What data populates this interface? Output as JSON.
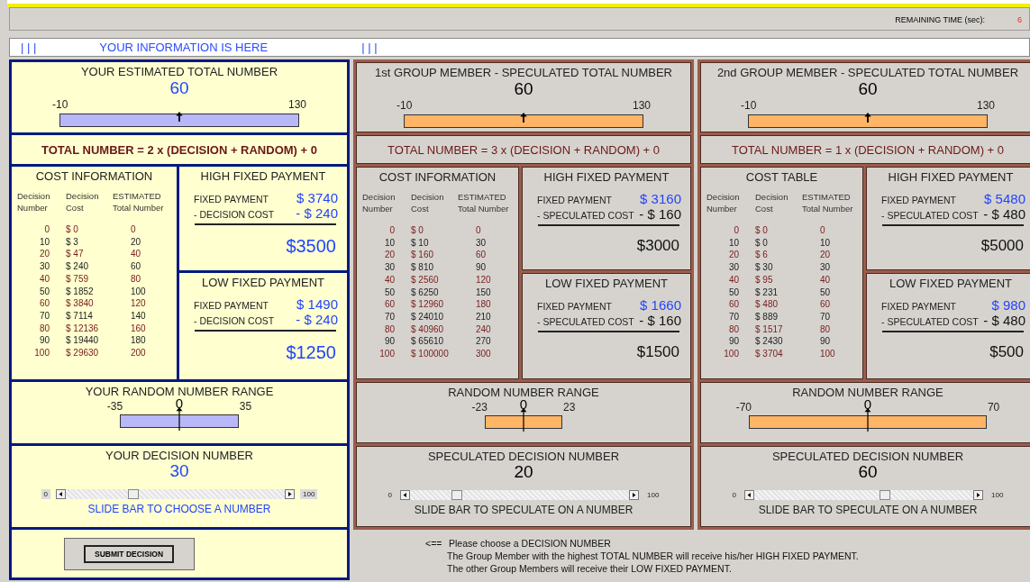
{
  "top_bar": {
    "label": "REMAINING TIME (sec):",
    "value": "6"
  },
  "info_bar": {
    "left_marks": "| | |",
    "text": "YOUR INFORMATION IS HERE",
    "right_marks": "| | |"
  },
  "panels": [
    {
      "kind": "self",
      "total": {
        "title": "YOUR ESTIMATED TOTAL NUMBER",
        "value": "60",
        "min": "-10",
        "max": "130",
        "level": 0.5
      },
      "formula": "TOTAL NUMBER = 2 x (DECISION + RANDOM) + 0",
      "cost": {
        "title": "COST INFORMATION",
        "columns": [
          "Decision\nNumber",
          "Decision\nCost",
          "ESTIMATED\nTotal Number"
        ],
        "rows": [
          [
            "0",
            "$ 0",
            "0"
          ],
          [
            "10",
            "$ 3",
            "20"
          ],
          [
            "20",
            "$ 47",
            "40"
          ],
          [
            "30",
            "$ 240",
            "60"
          ],
          [
            "40",
            "$ 759",
            "80"
          ],
          [
            "50",
            "$ 1852",
            "100"
          ],
          [
            "60",
            "$ 3840",
            "120"
          ],
          [
            "70",
            "$ 7114",
            "140"
          ],
          [
            "80",
            "$ 12136",
            "160"
          ],
          [
            "90",
            "$ 19440",
            "180"
          ],
          [
            "100",
            "$ 29630",
            "200"
          ]
        ]
      },
      "payments": [
        {
          "title": "HIGH FIXED PAYMENT",
          "fixed_label": "FIXED PAYMENT",
          "fixed_value": "$ 3740",
          "cost_label": "- DECISION COST",
          "cost_value": "- $ 240",
          "net": "$3500"
        },
        {
          "title": "LOW FIXED PAYMENT",
          "fixed_label": "FIXED PAYMENT",
          "fixed_value": "$ 1490",
          "cost_label": "- DECISION COST",
          "cost_value": "- $ 240",
          "net": "$1250"
        }
      ],
      "random": {
        "title": "YOUR RANDOM NUMBER RANGE",
        "min": "-35",
        "center": "0",
        "max": "35"
      },
      "decision": {
        "title": "YOUR DECISION NUMBER",
        "value": "30",
        "min": "0",
        "max": "100",
        "level": 0.3,
        "hint": "SLIDE BAR TO CHOOSE A NUMBER"
      }
    },
    {
      "kind": "member",
      "total": {
        "title": "1st GROUP MEMBER - SPECULATED TOTAL NUMBER",
        "value": "60",
        "min": "-10",
        "max": "130",
        "level": 0.5
      },
      "formula": "TOTAL NUMBER = 3 x (DECISION + RANDOM) + 0",
      "cost": {
        "title": "COST INFORMATION",
        "columns": [
          "Decision\nNumber",
          "Decision\nCost",
          "ESTIMATED\nTotal Number"
        ],
        "rows": [
          [
            "0",
            "$ 0",
            "0"
          ],
          [
            "10",
            "$ 10",
            "30"
          ],
          [
            "20",
            "$ 160",
            "60"
          ],
          [
            "30",
            "$ 810",
            "90"
          ],
          [
            "40",
            "$ 2560",
            "120"
          ],
          [
            "50",
            "$ 6250",
            "150"
          ],
          [
            "60",
            "$ 12960",
            "180"
          ],
          [
            "70",
            "$ 24010",
            "210"
          ],
          [
            "80",
            "$ 40960",
            "240"
          ],
          [
            "90",
            "$ 65610",
            "270"
          ],
          [
            "100",
            "$ 100000",
            "300"
          ]
        ]
      },
      "payments": [
        {
          "title": "HIGH FIXED PAYMENT",
          "fixed_label": "FIXED PAYMENT",
          "fixed_value": "$ 3160",
          "cost_label": "- SPECULATED COST",
          "cost_value": "- $ 160",
          "net": "$3000"
        },
        {
          "title": "LOW FIXED PAYMENT",
          "fixed_label": "FIXED PAYMENT",
          "fixed_value": "$ 1660",
          "cost_label": "- SPECULATED COST",
          "cost_value": "- $ 160",
          "net": "$1500"
        }
      ],
      "random": {
        "title": "RANDOM NUMBER RANGE",
        "min": "-23",
        "center": "0",
        "max": "23"
      },
      "decision": {
        "title": "SPECULATED DECISION NUMBER",
        "value": "20",
        "min": "0",
        "max": "100",
        "level": 0.2,
        "hint": "SLIDE BAR TO SPECULATE ON A NUMBER"
      }
    },
    {
      "kind": "member",
      "total": {
        "title": "2nd GROUP MEMBER - SPECULATED TOTAL NUMBER",
        "value": "60",
        "min": "-10",
        "max": "130",
        "level": 0.5
      },
      "formula": "TOTAL NUMBER = 1 x (DECISION + RANDOM) + 0",
      "cost": {
        "title": "COST  TABLE",
        "columns": [
          "Decision\nNumber",
          "Decision\nCost",
          "ESTIMATED\nTotal Number"
        ],
        "rows": [
          [
            "0",
            "$ 0",
            "0"
          ],
          [
            "10",
            "$ 0",
            "10"
          ],
          [
            "20",
            "$ 6",
            "20"
          ],
          [
            "30",
            "$ 30",
            "30"
          ],
          [
            "40",
            "$ 95",
            "40"
          ],
          [
            "50",
            "$ 231",
            "50"
          ],
          [
            "60",
            "$ 480",
            "60"
          ],
          [
            "70",
            "$ 889",
            "70"
          ],
          [
            "80",
            "$ 1517",
            "80"
          ],
          [
            "90",
            "$ 2430",
            "90"
          ],
          [
            "100",
            "$ 3704",
            "100"
          ]
        ]
      },
      "payments": [
        {
          "title": "HIGH FIXED PAYMENT",
          "fixed_label": "FIXED PAYMENT",
          "fixed_value": "$ 5480",
          "cost_label": "- SPECULATED COST",
          "cost_value": "- $ 480",
          "net": "$5000"
        },
        {
          "title": "LOW FIXED PAYMENT",
          "fixed_label": "FIXED PAYMENT",
          "fixed_value": "$ 980",
          "cost_label": "- SPECULATED COST",
          "cost_value": "- $ 480",
          "net": "$500"
        }
      ],
      "random": {
        "title": "RANDOM NUMBER RANGE",
        "min": "-70",
        "center": "0",
        "max": "70"
      },
      "decision": {
        "title": "SPECULATED DECISION NUMBER",
        "value": "60",
        "min": "0",
        "max": "100",
        "level": 0.6,
        "hint": "SLIDE BAR TO SPECULATE ON A NUMBER"
      }
    }
  ],
  "submit": {
    "label": "SUBMIT DECISION"
  },
  "instructions": {
    "arrow": "<==",
    "lines": [
      "Please choose a DECISION NUMBER",
      "The Group Member with the highest TOTAL NUMBER will receive his/her HIGH FIXED PAYMENT.",
      "The other Group Members will receive their LOW FIXED PAYMENT."
    ]
  }
}
